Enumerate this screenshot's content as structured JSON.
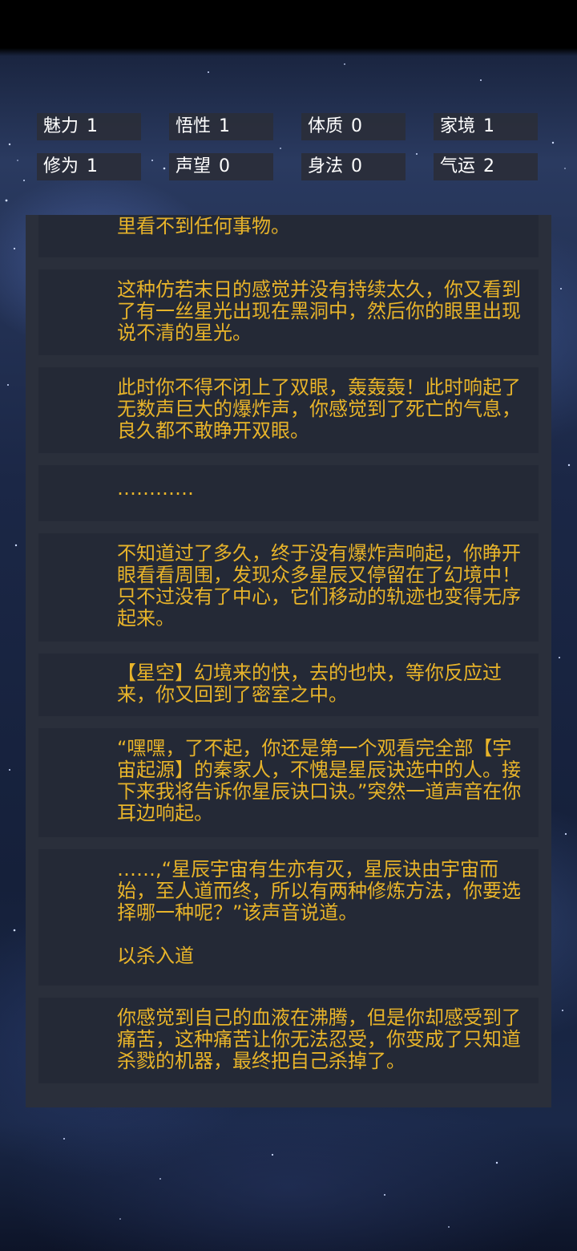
{
  "stats": [
    {
      "label": "魅力",
      "value": "1"
    },
    {
      "label": "悟性",
      "value": "1"
    },
    {
      "label": "体质",
      "value": "0"
    },
    {
      "label": "家境",
      "value": "1"
    },
    {
      "label": "修为",
      "value": "1"
    },
    {
      "label": "声望",
      "value": "0"
    },
    {
      "label": "身法",
      "value": "0"
    },
    {
      "label": "气运",
      "value": "2"
    }
  ],
  "story": {
    "entries": [
      {
        "text": "波动更加不稳定起来，当黑便达到极致时，你眼里看不到任何事物。"
      },
      {
        "text": "这种仿若末日的感觉并没有持续太久，你又看到了有一丝星光出现在黑洞中，然后你的眼里出现说不清的星光。"
      },
      {
        "text": "此时你不得不闭上了双眼，轰轰轰！此时响起了无数声巨大的爆炸声，你感觉到了死亡的气息，良久都不敢睁开双眼。"
      },
      {
        "text": "…………"
      },
      {
        "text": "不知道过了多久，终于没有爆炸声响起，你睁开眼看看周围，发现众多星辰又停留在了幻境中！只不过没有了中心，它们移动的轨迹也变得无序起来。"
      },
      {
        "text": "【星空】幻境来的快，去的也快，等你反应过来，你又回到了密室之中。"
      },
      {
        "text": "“嘿嘿，了不起，你还是第一个观看完全部【宇宙起源】的秦家人，不愧是星辰诀选中的人。接下来我将告诉你星辰诀口诀。”突然一道声音在你耳边响起。"
      },
      {
        "text": "……,“星辰宇宙有生亦有灭，星辰诀由宇宙而始，至人道而终，所以有两种修炼方法，你要选择哪一种呢？”该声音说道。",
        "option": "以杀入道"
      },
      {
        "text": "你感觉到自己的血液在沸腾，但是你却感受到了痛苦，这种痛苦让你无法忍受，你变成了只知道杀戮的机器，最终把自己杀掉了。"
      }
    ]
  },
  "colors": {
    "story_text": "#e8b42a",
    "stat_text": "#ffffff",
    "card_bg": "#242936",
    "panel_bg": "#2a2f3b"
  }
}
